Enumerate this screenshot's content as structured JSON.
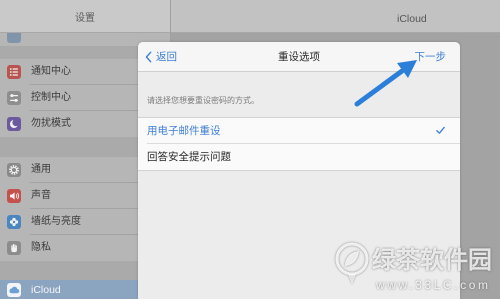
{
  "header": {
    "left_title": "设置",
    "right_title": "iCloud"
  },
  "sidebar": {
    "items": [
      {
        "label": "通知中心",
        "icon": "notification-center-icon",
        "icon_color": "#b9554f"
      },
      {
        "label": "控制中心",
        "icon": "control-center-icon",
        "icon_color": "#8e8e8e"
      },
      {
        "label": "勿扰模式",
        "icon": "moon-icon",
        "icon_color": "#6b5b9e"
      },
      {
        "label": "通用",
        "icon": "gear-icon",
        "icon_color": "#8a8a8a"
      },
      {
        "label": "声音",
        "icon": "speaker-icon",
        "icon_color": "#c4514c"
      },
      {
        "label": "墙纸与亮度",
        "icon": "wallpaper-flower-icon",
        "icon_color": "#4b86c0"
      },
      {
        "label": "隐私",
        "icon": "hand-icon",
        "icon_color": "#8c8c8c"
      },
      {
        "label": "iCloud",
        "icon": "cloud-icon",
        "icon_color": "#f2f4f7",
        "selected": true
      }
    ]
  },
  "modal": {
    "back_label": "返回",
    "title": "重设选项",
    "next_label": "下一步",
    "section_header": "请选择您想要重设密码的方式。",
    "options": [
      {
        "label": "用电子邮件重设",
        "selected": true
      },
      {
        "label": "回答安全提示问题",
        "selected": false
      }
    ]
  },
  "annotation": {
    "arrow_color": "#2b7fd9"
  },
  "watermark": {
    "brand": "绿茶软件园",
    "url": "www.33LC.com"
  },
  "colors": {
    "accent": "#3d7fd6",
    "selected_row": "#8ba4c0",
    "sheet_background": "#ececec"
  }
}
